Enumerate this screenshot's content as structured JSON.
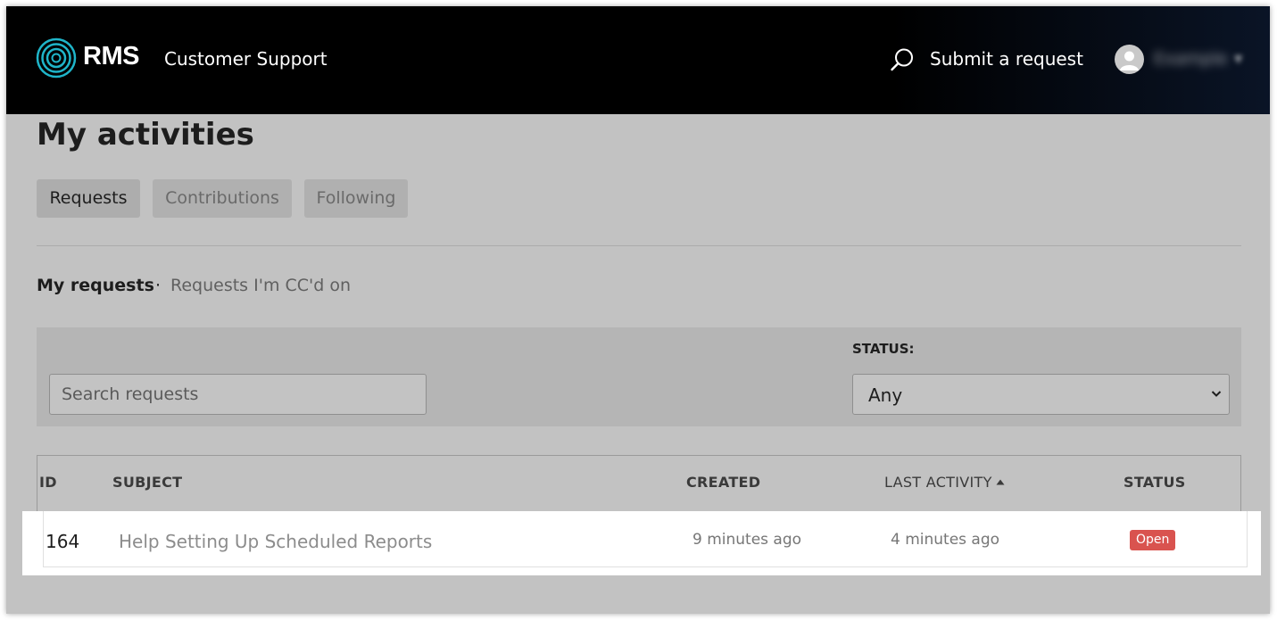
{
  "header": {
    "logo_text": "RMS",
    "brand_subtitle": "Customer Support",
    "submit_label": "Submit a request",
    "user_name": "Example"
  },
  "page": {
    "title": "My activities"
  },
  "tabs": [
    {
      "label": "Requests",
      "active": true
    },
    {
      "label": "Contributions",
      "active": false
    },
    {
      "label": "Following",
      "active": false
    }
  ],
  "subnav": {
    "active": "My requests",
    "separator": "·",
    "other": "Requests I'm CC'd on"
  },
  "filters": {
    "search_placeholder": "Search requests",
    "status_label": "STATUS:",
    "status_value": "Any"
  },
  "table": {
    "columns": [
      "ID",
      "SUBJECT",
      "CREATED",
      "LAST ACTIVITY",
      "STATUS"
    ],
    "rows": [
      {
        "id": "164",
        "subject": "Help Setting Up Scheduled Reports",
        "created": "9 minutes ago",
        "last_activity": "4 minutes ago",
        "status": "Open"
      }
    ]
  },
  "colors": {
    "header_bg": "#000000",
    "logo_accent": "#1fb5c9",
    "status_open": "#d9534f"
  }
}
